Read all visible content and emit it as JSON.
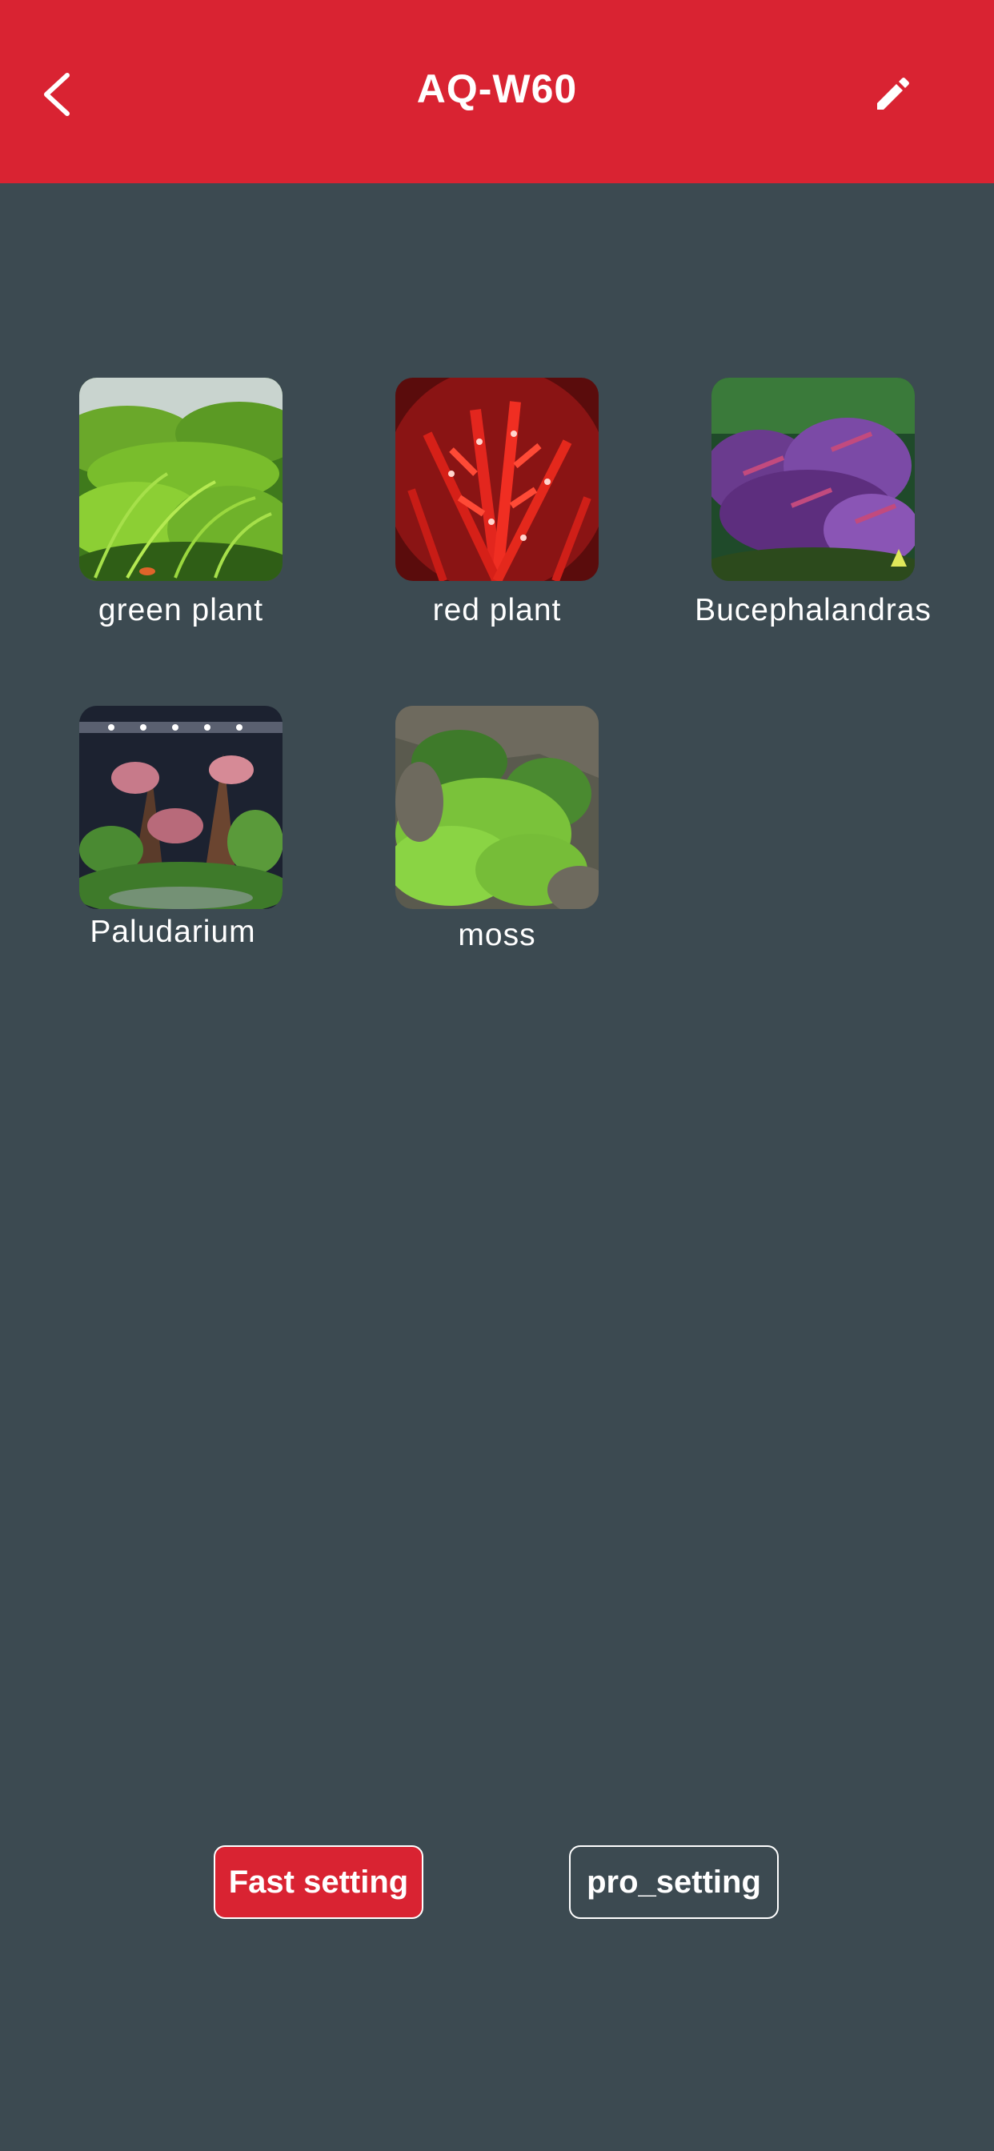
{
  "header": {
    "title": "AQ-W60",
    "back_icon": "chevron-left-icon",
    "edit_icon": "pencil-icon",
    "background_color": "#d92332"
  },
  "scenes": [
    {
      "label": "green plant"
    },
    {
      "label": "red plant"
    },
    {
      "label": "Bucephalandras"
    },
    {
      "label": "Paludarium"
    },
    {
      "label": "moss"
    }
  ],
  "actions": {
    "fast_label": "Fast setting",
    "pro_label": "pro_setting"
  },
  "colors": {
    "accent": "#d92332",
    "background": "#3c4a51"
  }
}
